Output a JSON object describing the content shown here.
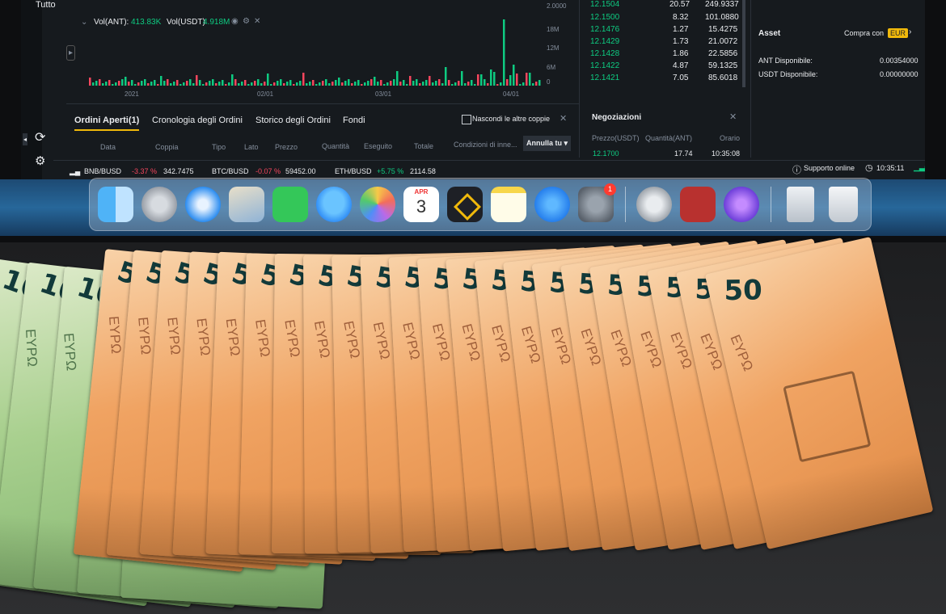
{
  "trading": {
    "sidebar_label": "Tutto",
    "chart": {
      "volume_label": "Vol(ANT):",
      "volume_ant": "413.83K",
      "volume_usdt_label": "Vol(USDT)",
      "volume_usdt": "4.918M",
      "y_ticks": [
        "2.0000",
        "18M",
        "12M",
        "6M",
        "0"
      ],
      "x_ticks": [
        "2021",
        "02/01",
        "03/01",
        "04/01"
      ]
    },
    "orderbook_rows": [
      {
        "price": "12.1504",
        "amount": "20.57",
        "total": "249.9337"
      },
      {
        "price": "12.1500",
        "amount": "8.32",
        "total": "101.0880"
      },
      {
        "price": "12.1476",
        "amount": "1.27",
        "total": "15.4275"
      },
      {
        "price": "12.1429",
        "amount": "1.73",
        "total": "21.0072"
      },
      {
        "price": "12.1428",
        "amount": "1.86",
        "total": "22.5856"
      },
      {
        "price": "12.1422",
        "amount": "4.87",
        "total": "59.1325"
      },
      {
        "price": "12.1421",
        "amount": "7.05",
        "total": "85.6018"
      }
    ],
    "asset_panel": {
      "title": "Asset",
      "buy_with": "Compra con",
      "currency": "EUR",
      "ant_label": "ANT Disponibile:",
      "ant_value": "0.00354000",
      "usdt_label": "USDT Disponibile:",
      "usdt_value": "0.00000000"
    },
    "orders_tabs": [
      "Ordini Aperti(1)",
      "Cronologia degli Ordini",
      "Storico degli Ordini",
      "Fondi"
    ],
    "hide_pairs_label": "Nascondi le altre coppie",
    "orders_columns": [
      "Data",
      "Coppia",
      "Tipo",
      "Lato",
      "Prezzo",
      "Quantità",
      "Eseguito",
      "Totale",
      "Condizioni di inne...",
      "Annulla tu"
    ],
    "trades": {
      "title": "Negoziazioni",
      "columns": [
        "Prezzo(USDT)",
        "Quantità(ANT)",
        "Orario"
      ],
      "row": {
        "price": "12.1700",
        "qty": "17.74",
        "time": "10:35:08"
      }
    },
    "ticker": [
      {
        "pair": "BNB/BUSD",
        "change": "-3.37 %",
        "price": "342.7475",
        "dir": "down"
      },
      {
        "pair": "BTC/BUSD",
        "change": "-0.07 %",
        "price": "59452.00",
        "dir": "down"
      },
      {
        "pair": "ETH/BUSD",
        "change": "+5.75 %",
        "price": "2114.58",
        "dir": "up"
      }
    ],
    "support_label": "Supporto online",
    "clock": "10:35:11"
  },
  "dock": {
    "apps": [
      "finder-icon",
      "launchpad-icon",
      "safari-icon",
      "preview-icon",
      "facetime-icon",
      "messages-icon",
      "photos-icon",
      "calendar-icon",
      "binance-icon",
      "notes-icon",
      "app-store-icon",
      "system-preferences-icon",
      "automator-icon",
      "photo-booth-icon",
      "imovie-icon",
      "downloads-stack-icon",
      "trash-icon"
    ],
    "calendar_month": "APR",
    "calendar_day": "3",
    "sysprefs_badge": "1"
  },
  "banknotes": {
    "denomination_100": "100",
    "denomination_50": "50",
    "currency_text": "EYPΩ",
    "count_100": 5,
    "count_50": 22,
    "colors": {
      "note_50": "#f0a362",
      "note_100": "#a9d08f"
    }
  }
}
